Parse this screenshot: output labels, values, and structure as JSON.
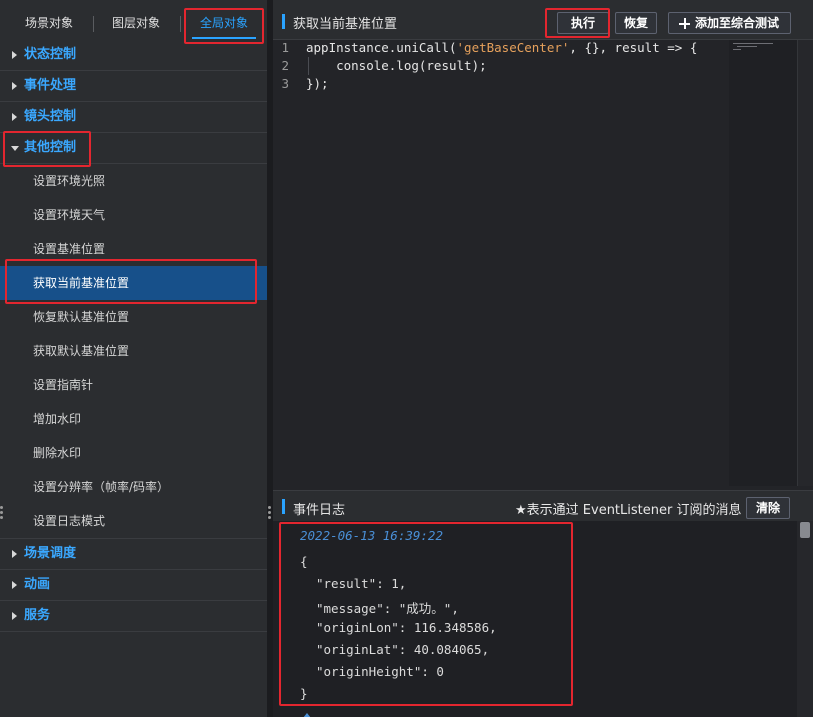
{
  "sidebar": {
    "tabs": [
      {
        "label": "场景对象"
      },
      {
        "label": "图层对象"
      },
      {
        "label": "全局对象",
        "active": true
      }
    ],
    "groups": {
      "state": "状态控制",
      "events": "事件处理",
      "camera": "镜头控制",
      "other": "其他控制",
      "scene": "场景调度",
      "animation": "动画",
      "service": "服务"
    },
    "items": [
      "设置环境光照",
      "设置环境天气",
      "设置基准位置",
      "获取当前基准位置",
      "恢复默认基准位置",
      "获取默认基准位置",
      "设置指南针",
      "增加水印",
      "删除水印",
      "设置分辨率（帧率/码率）",
      "设置日志模式"
    ]
  },
  "editor": {
    "title": "获取当前基准位置",
    "run_label": "执行",
    "restore_label": "恢复",
    "add_label": "添加至综合测试",
    "lines": {
      "n1": "1",
      "n2": "2",
      "n3": "3",
      "l1_pre": "appInstance.uniCall(",
      "l1_str": "'getBaseCenter'",
      "l1_post": ", {}, result => {",
      "l2": "    console.log(result);",
      "l3": "});"
    }
  },
  "log": {
    "title": "事件日志",
    "note": "★表示通过 EventListener 订阅的消息",
    "clear_label": "清除",
    "timestamp": "2022-06-13 16:39:22",
    "open_brace": "{",
    "close_brace": "}",
    "json_lines": [
      "\"result\": 1,",
      "\"message\": \"成功。\",",
      "\"originLon\": 116.348586,",
      "\"originLat\": 40.084065,",
      "\"originHeight\": 0"
    ]
  },
  "colors": {
    "accent": "#2aa3ff",
    "highlight_box": "#e3262f",
    "selected_bg": "#17508a",
    "string": "#e6a15c",
    "timestamp": "#4a8fd6"
  },
  "icons": {
    "collapsed": "caret-right-icon",
    "expanded": "caret-down-icon",
    "add": "plus-icon",
    "resize": "grip-dots-icon"
  }
}
